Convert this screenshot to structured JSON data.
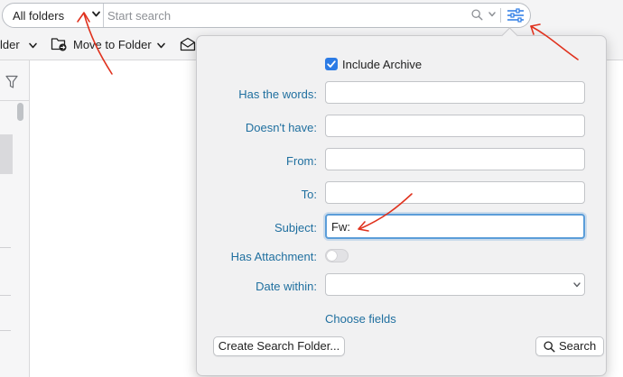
{
  "search": {
    "scope_label": "All folders",
    "placeholder": "Start search",
    "value": ""
  },
  "toolbar": {
    "folder_partial_label": "lder",
    "move_to_folder_label": "Move to Folder"
  },
  "panel": {
    "include_archive_label": "Include Archive",
    "include_archive_checked": true,
    "rows": {
      "has_words": {
        "label": "Has the words:",
        "value": ""
      },
      "doesnt_have": {
        "label": "Doesn't have:",
        "value": ""
      },
      "from": {
        "label": "From:",
        "value": ""
      },
      "to": {
        "label": "To:",
        "value": ""
      },
      "subject": {
        "label": "Subject:",
        "value": "Fw:"
      }
    },
    "has_attachment_label": "Has Attachment:",
    "has_attachment_on": false,
    "date_within_label": "Date within:",
    "date_within_value": "",
    "choose_fields_label": "Choose fields",
    "create_search_folder_label": "Create Search Folder...",
    "search_button_label": "Search"
  },
  "colors": {
    "accent_blue": "#2c7be5",
    "label_teal": "#1f6f9f",
    "annotation_red": "#e0321e"
  }
}
